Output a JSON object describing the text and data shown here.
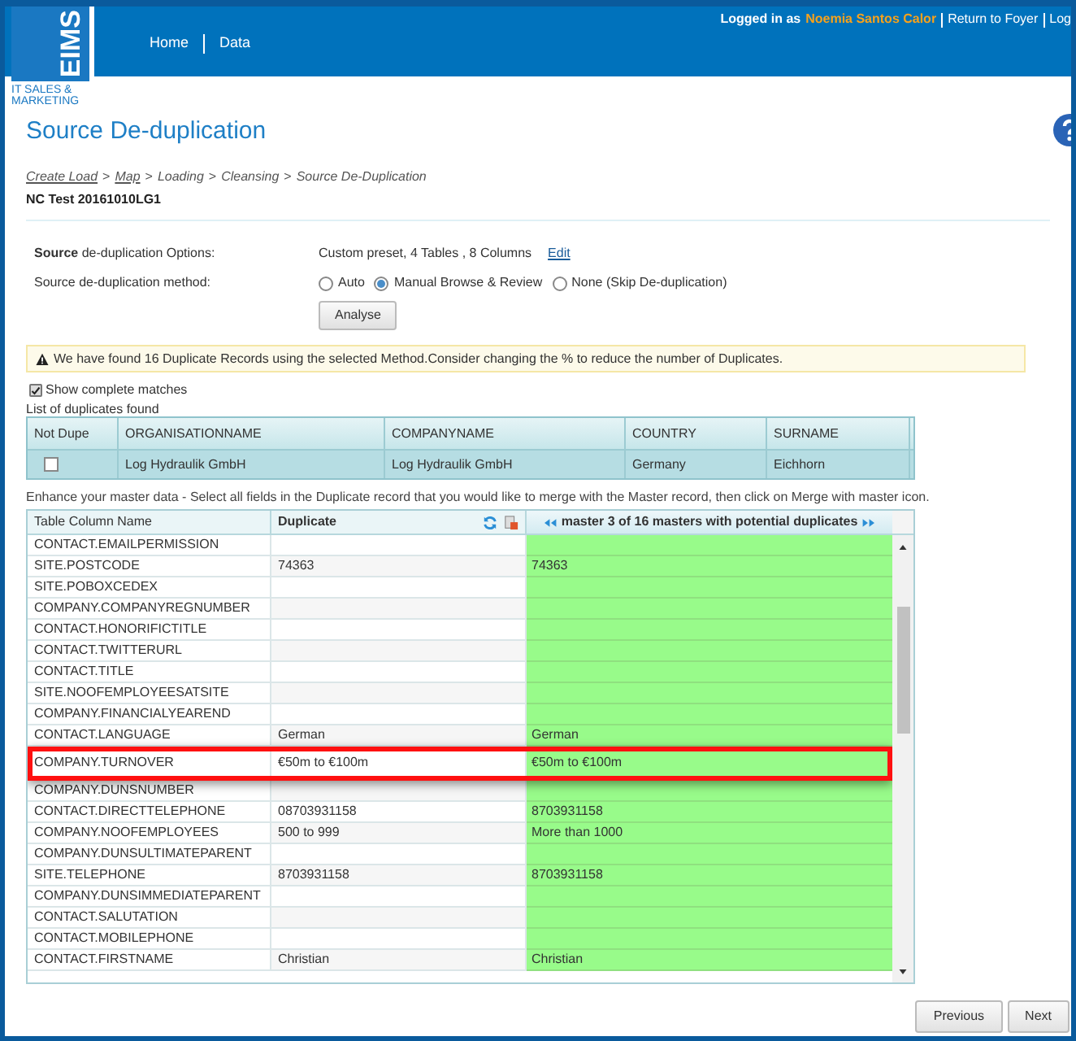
{
  "header": {
    "logo": "EIMS",
    "logo_caption": "IT SALES & MARKETING",
    "nav": [
      "Home",
      "Data"
    ],
    "logged_in_label": "Logged in as",
    "user": "Noemia Santos Calor",
    "links": [
      "Return to Foyer",
      "Log"
    ]
  },
  "title": "Source De-duplication",
  "breadcrumb": [
    {
      "kind": "link",
      "label": "Create Load"
    },
    {
      "kind": "separator",
      "label": ">"
    },
    {
      "kind": "link",
      "label": "Map"
    },
    {
      "kind": "separator",
      "label": ">"
    },
    {
      "kind": "text",
      "label": "Loading"
    },
    {
      "kind": "separator",
      "label": ">"
    },
    {
      "kind": "text",
      "label": "Cleansing"
    },
    {
      "kind": "separator",
      "label": ">"
    },
    {
      "kind": "text",
      "label": "Source De-Duplication"
    }
  ],
  "load_name": "NC Test 20161010LG1",
  "options": {
    "label": "**Source** de-duplication Options:",
    "value": "Custom preset, 4 Tables , 8 Columns",
    "edit": "Edit"
  },
  "method": {
    "label": "Source de-duplication method:",
    "choices": [
      {
        "label": "Auto",
        "selected": false
      },
      {
        "label": "Manual Browse & Review",
        "selected": true
      },
      {
        "label": "None (Skip De-duplication)",
        "selected": false
      }
    ]
  },
  "analyse_button": "Analyse",
  "alert": "We have found 16 Duplicate Records using the selected Method.Consider changing the % to reduce the number of Duplicates.",
  "show_complete_matches": {
    "label": "Show complete matches",
    "checked": true
  },
  "duplicates_label": "List of duplicates found",
  "duplicates": {
    "columns": [
      "Not Dupe",
      "ORGANISATIONNAME",
      "COMPANYNAME",
      "COUNTRY",
      "SURNAME"
    ],
    "rows": [
      {
        "not_dupe": false,
        "organisationname": "Log Hydraulik GmbH",
        "companyname": "Log Hydraulik GmbH",
        "country": "Germany",
        "surname": "Eichhorn"
      }
    ]
  },
  "enhance_text": "Enhance your master data - Select all fields in the Duplicate record that you would like to merge with the Master record, then click on Merge with master icon.",
  "merge": {
    "columns": [
      "Table Column Name",
      "Duplicate",
      "master 3 of 16 masters with potential duplicates"
    ],
    "rows": [
      {
        "name": "CONTACT.EMAILPERMISSION",
        "duplicate": "",
        "master": "",
        "highlighted": false
      },
      {
        "name": "SITE.POSTCODE",
        "duplicate": "74363",
        "master": "74363",
        "highlighted": false
      },
      {
        "name": "SITE.POBOXCEDEX",
        "duplicate": "",
        "master": "",
        "highlighted": false
      },
      {
        "name": "COMPANY.COMPANYREGNUMBER",
        "duplicate": "",
        "master": "",
        "highlighted": false
      },
      {
        "name": "CONTACT.HONORIFICTITLE",
        "duplicate": "",
        "master": "",
        "highlighted": false
      },
      {
        "name": "CONTACT.TWITTERURL",
        "duplicate": "",
        "master": "",
        "highlighted": false
      },
      {
        "name": "CONTACT.TITLE",
        "duplicate": "",
        "master": "",
        "highlighted": false
      },
      {
        "name": "SITE.NOOFEMPLOYEESATSITE",
        "duplicate": "",
        "master": "",
        "highlighted": false
      },
      {
        "name": "COMPANY.FINANCIALYEAREND",
        "duplicate": "",
        "master": "",
        "highlighted": false
      },
      {
        "name": "CONTACT.LANGUAGE",
        "duplicate": "German",
        "master": "German",
        "highlighted": false
      },
      {
        "name": "COMPANY.TURNOVER",
        "duplicate": "€50m to €100m",
        "master": "€50m to €100m",
        "highlighted": true
      },
      {
        "name": "COMPANY.DUNSNUMBER",
        "duplicate": "",
        "master": "",
        "highlighted": false
      },
      {
        "name": "CONTACT.DIRECTTELEPHONE",
        "duplicate": "08703931158",
        "master": "8703931158",
        "highlighted": false
      },
      {
        "name": "COMPANY.NOOFEMPLOYEES",
        "duplicate": "500 to 999",
        "master": "More than 1000",
        "highlighted": false
      },
      {
        "name": "COMPANY.DUNSULTIMATEPARENT",
        "duplicate": "",
        "master": "",
        "highlighted": false
      },
      {
        "name": "SITE.TELEPHONE",
        "duplicate": "8703931158",
        "master": "8703931158",
        "highlighted": false
      },
      {
        "name": "COMPANY.DUNSIMMEDIATEPARENT",
        "duplicate": "",
        "master": "",
        "highlighted": false
      },
      {
        "name": "CONTACT.SALUTATION",
        "duplicate": "",
        "master": "",
        "highlighted": false
      },
      {
        "name": "CONTACT.MOBILEPHONE",
        "duplicate": "",
        "master": "",
        "highlighted": false
      },
      {
        "name": "CONTACT.FIRSTNAME",
        "duplicate": "Christian",
        "master": "Christian",
        "highlighted": false
      }
    ]
  },
  "buttons": [
    "Previous",
    "Next"
  ]
}
